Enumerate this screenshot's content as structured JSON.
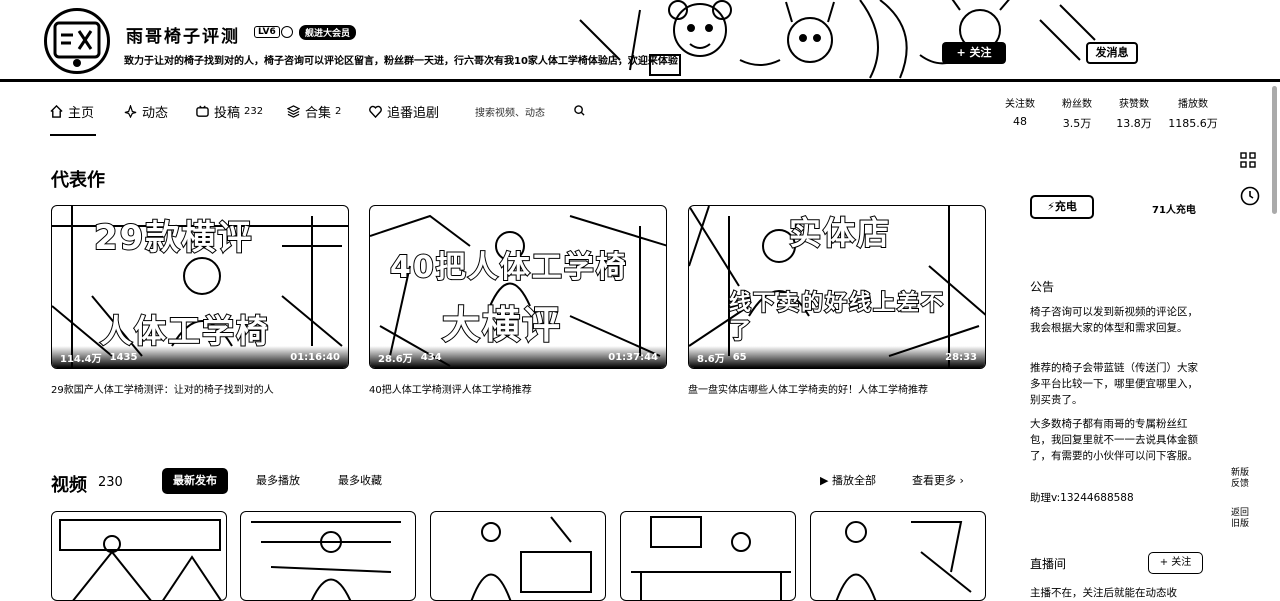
{
  "banner": {
    "name": "雨哥椅子评测",
    "level": "LV6",
    "badge": "舰进大会员",
    "sign": "致力于让对的椅子找到对的人，椅子咨询可以评论区留言，粉丝群一天进，行六哥次有我10家人体工学椅体验店，欢迎来体验",
    "follow": "+ 关注",
    "message": "发消息"
  },
  "nav": {
    "home": "主页",
    "dynamic": "动态",
    "posts": "投稿",
    "posts_count": "232",
    "collections": "合集",
    "collections_count": "2",
    "bangumi": "追番追剧",
    "search_placeholder": "搜索视频、动态"
  },
  "stats": [
    {
      "label": "关注数",
      "value": "48"
    },
    {
      "label": "粉丝数",
      "value": "3.5万"
    },
    {
      "label": "获赞数",
      "value": "13.8万"
    },
    {
      "label": "播放数",
      "value": "1185.6万"
    }
  ],
  "featured": {
    "heading": "代表作",
    "cards": [
      {
        "thumb_top": "29款横评",
        "thumb_bottom": "人体工学椅",
        "plays": "114.4万",
        "comments": "1435",
        "duration": "01:16:40",
        "title": "29款国产人体工学椅测评：让对的椅子找到对的人"
      },
      {
        "thumb_top": "40把人体工学椅",
        "thumb_bottom": "大横评",
        "plays": "28.6万",
        "comments": "434",
        "duration": "01:37:44",
        "title": "40把人体工学椅测评人体工学椅推荐"
      },
      {
        "thumb_top": "实体店",
        "thumb_bottom": "线下卖的好线上差不了",
        "plays": "8.6万",
        "comments": "65",
        "duration": "28:33",
        "title": "盘一盘实体店哪些人体工学椅卖的好！人体工学椅推荐"
      }
    ]
  },
  "videos": {
    "heading": "视频",
    "count": "230",
    "sort_latest": "最新发布",
    "sort_plays": "最多播放",
    "sort_favs": "最多收藏",
    "play_all": "播放全部",
    "see_more": "查看更多"
  },
  "sidebar": {
    "charge_label": "充电",
    "charge_count": "71人充电",
    "announcement_title": "公告",
    "announcement": [
      "椅子咨询可以发到新视频的评论区，我会根据大家的体型和需求回复。",
      "推荐的椅子会带蓝链（传送门）大家多平台比较一下，哪里便宜哪里入，别买贵了。",
      "大多数椅子都有雨哥的专属粉丝红包，我回复里就不一一去说具体金额了，有需要的小伙伴可以问下客服。",
      "助理v:13244688588"
    ],
    "live_title": "直播间",
    "live_follow": "+ 关注",
    "live_text": "主播不在，关注后就能在动态收"
  },
  "side_links": {
    "new_version": "新版反馈",
    "old_version": "返回旧版"
  }
}
